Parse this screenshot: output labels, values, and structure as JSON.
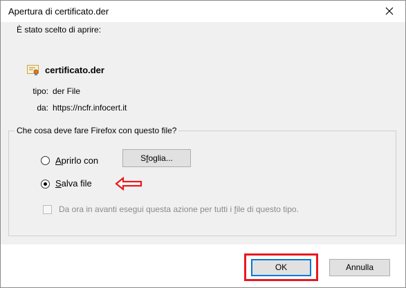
{
  "dialog": {
    "title": "Apertura di certificato.der",
    "close_icon": "close-icon"
  },
  "info": {
    "chosen_text": "È stato scelto di aprire:",
    "file_icon": "certificate-file-icon",
    "file_name": "certificato.der",
    "type_label": "tipo:",
    "type_value": "der File",
    "from_label": "da:",
    "from_value": "https://ncfr.infocert.it"
  },
  "action_group": {
    "title": "Che cosa deve fare Firefox con questo file?",
    "open_with": {
      "label_mnemonic": "A",
      "label_rest": "prirlo con",
      "selected": false
    },
    "browse_button": {
      "label_pre": "S",
      "label_mnemonic": "f",
      "label_rest": "oglia..."
    },
    "save_file": {
      "label_mnemonic": "S",
      "label_rest": "alva file",
      "selected": true
    },
    "annotation_arrow": {
      "icon": "red-arrow-left-icon",
      "color": "#e8191f"
    },
    "always_checkbox": {
      "label_pre": "Da ora in avanti esegui questa azione per tutti i ",
      "label_mnemonic": "f",
      "label_rest": "ile di questo tipo.",
      "checked": false,
      "disabled": true
    }
  },
  "buttons": {
    "ok_label": "OK",
    "cancel_label": "Annulla",
    "highlight_color": "#e8191f"
  }
}
